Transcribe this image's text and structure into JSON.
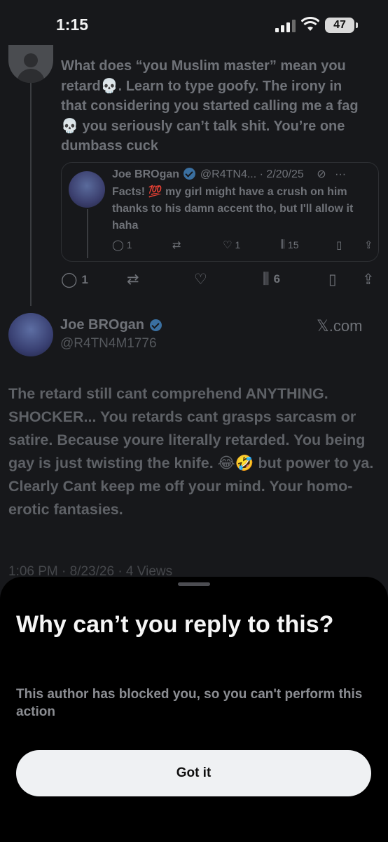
{
  "status_bar": {
    "time": "1:15",
    "battery": "47"
  },
  "reply_tweet": {
    "text": "What does “you Muslim master” mean you retard💀. Learn to type goofy.  The irony in that considering you started calling me a fag💀 you seriously can’t talk shit. You’re one dumbass cuck",
    "quote": {
      "name": "Joe BROgan",
      "handle": "@R4TN4...",
      "date": "· 2/20/25",
      "text": "Facts! 💯    my girl might have a crush on him thanks to his damn accent tho,  but I'll allow it haha",
      "replies": "1",
      "likes": "1",
      "views": "15"
    },
    "actions": {
      "replies": "1",
      "views": "6"
    }
  },
  "main_tweet": {
    "name": "Joe BROgan",
    "handle": "@R4TN4M1776",
    "source": "𝕏.com",
    "text": "The retard still cant comprehend ANYTHING. SHOCKER... You retards cant grasps sarcasm or satire.  Because youre literally retarded. You being gay is just twisting the knife. 😂🤣 but power to ya. Clearly  Cant keep me off your mind. Your homo-erotic fantasies.",
    "meta": "1:06 PM · 8/23/26 · 4 Views"
  },
  "sheet": {
    "title": "Why can’t you reply to this?",
    "description": "This author has blocked you, so you can't perform this action",
    "button": "Got it"
  }
}
